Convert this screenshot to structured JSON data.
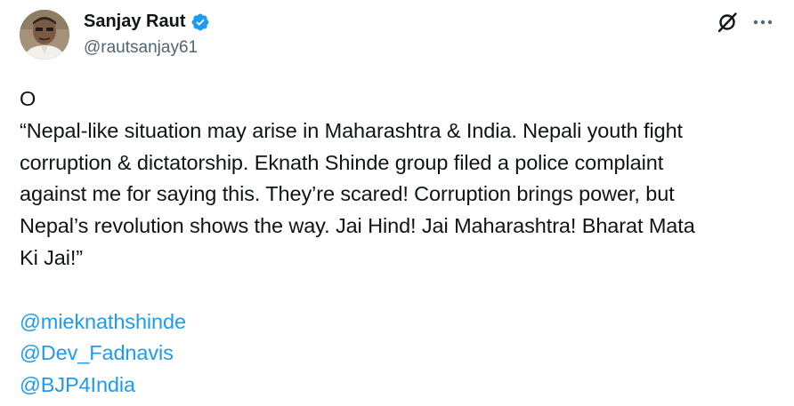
{
  "author": {
    "name": "Sanjay Raut",
    "handle": "@rautsanjay61",
    "verified": true,
    "verified_color": "#1d9bf0"
  },
  "actions": {
    "grok_icon": "grok-slash-circle-icon",
    "more_icon": "more-horizontal-icon"
  },
  "tweet": {
    "lines": [
      "O",
      "“Nepal-like situation may arise in Maharashtra & India. Nepali youth fight",
      "corruption & dictatorship. Eknath Shinde group filed a police complaint",
      "against me for saying this. They’re scared! Corruption brings power, but",
      "Nepal’s revolution shows the way. Jai Hind! Jai Maharashtra! Bharat Mata",
      "Ki Jai!”"
    ],
    "mentions": [
      "@mieknathshinde",
      "@Dev_Fadnavis",
      "@BJP4India"
    ]
  },
  "colors": {
    "text": "#0f1419",
    "secondary": "#536471",
    "link": "#1d9bf0",
    "background": "#ffffff"
  }
}
